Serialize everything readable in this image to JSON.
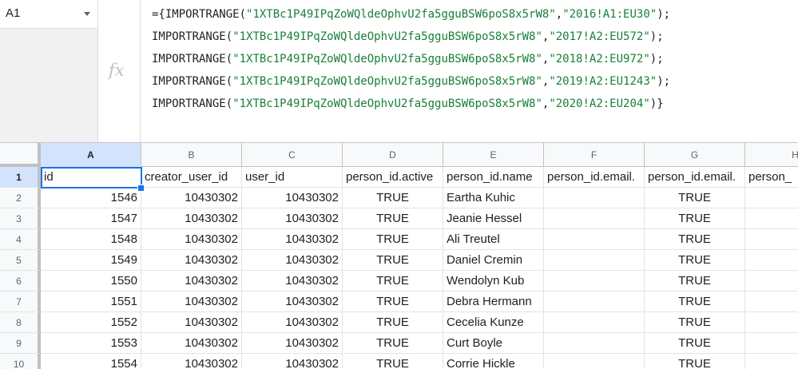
{
  "name_box": {
    "value": "A1"
  },
  "formula_bar": {
    "fx_label": "fx",
    "lines": [
      {
        "pre": "={IMPORTRANGE(",
        "key": "\"1XTBc1P49IPqZoWQldeOphvU2fa5gguBSW6poS8x5rW8\"",
        "sep": ",",
        "range": "\"2016!A1:EU30\"",
        "post": ");"
      },
      {
        "pre": "IMPORTRANGE(",
        "key": "\"1XTBc1P49IPqZoWQldeOphvU2fa5gguBSW6poS8x5rW8\"",
        "sep": ",",
        "range": "\"2017!A2:EU572\"",
        "post": ");"
      },
      {
        "pre": "IMPORTRANGE(",
        "key": "\"1XTBc1P49IPqZoWQldeOphvU2fa5gguBSW6poS8x5rW8\"",
        "sep": ",",
        "range": "\"2018!A2:EU972\"",
        "post": ");"
      },
      {
        "pre": "IMPORTRANGE(",
        "key": "\"1XTBc1P49IPqZoWQldeOphvU2fa5gguBSW6poS8x5rW8\"",
        "sep": ",",
        "range": "\"2019!A2:EU1243\"",
        "post": ");"
      },
      {
        "pre": "IMPORTRANGE(",
        "key": "\"1XTBc1P49IPqZoWQldeOphvU2fa5gguBSW6poS8x5rW8\"",
        "sep": ",",
        "range": "\"2020!A2:EU204\"",
        "post": ")}"
      }
    ]
  },
  "grid": {
    "columns": [
      "A",
      "B",
      "C",
      "D",
      "E",
      "F",
      "G",
      "H"
    ],
    "row_numbers": [
      "1",
      "2",
      "3",
      "4",
      "5",
      "6",
      "7",
      "8",
      "9",
      "10"
    ],
    "header_row": [
      "id",
      "creator_user_id",
      "user_id",
      "person_id.active",
      "person_id.name",
      "person_id.email.",
      "person_id.email.",
      "person_"
    ],
    "rows": [
      [
        "1546",
        "10430302",
        "10430302",
        "TRUE",
        "Eartha Kuhic",
        "",
        "TRUE",
        ""
      ],
      [
        "1547",
        "10430302",
        "10430302",
        "TRUE",
        "Jeanie Hessel",
        "",
        "TRUE",
        ""
      ],
      [
        "1548",
        "10430302",
        "10430302",
        "TRUE",
        "Ali Treutel",
        "",
        "TRUE",
        ""
      ],
      [
        "1549",
        "10430302",
        "10430302",
        "TRUE",
        "Daniel Cremin",
        "",
        "TRUE",
        ""
      ],
      [
        "1550",
        "10430302",
        "10430302",
        "TRUE",
        "Wendolyn Kub",
        "",
        "TRUE",
        ""
      ],
      [
        "1551",
        "10430302",
        "10430302",
        "TRUE",
        "Debra Hermann",
        "",
        "TRUE",
        ""
      ],
      [
        "1552",
        "10430302",
        "10430302",
        "TRUE",
        "Cecelia Kunze",
        "",
        "TRUE",
        ""
      ],
      [
        "1553",
        "10430302",
        "10430302",
        "TRUE",
        "Curt Boyle",
        "",
        "TRUE",
        ""
      ],
      [
        "1554",
        "10430302",
        "10430302",
        "TRUE",
        "Corrie Hickle",
        "",
        "TRUE",
        ""
      ]
    ],
    "selected_cell": "A1",
    "selection_color": "#1a73e8"
  }
}
